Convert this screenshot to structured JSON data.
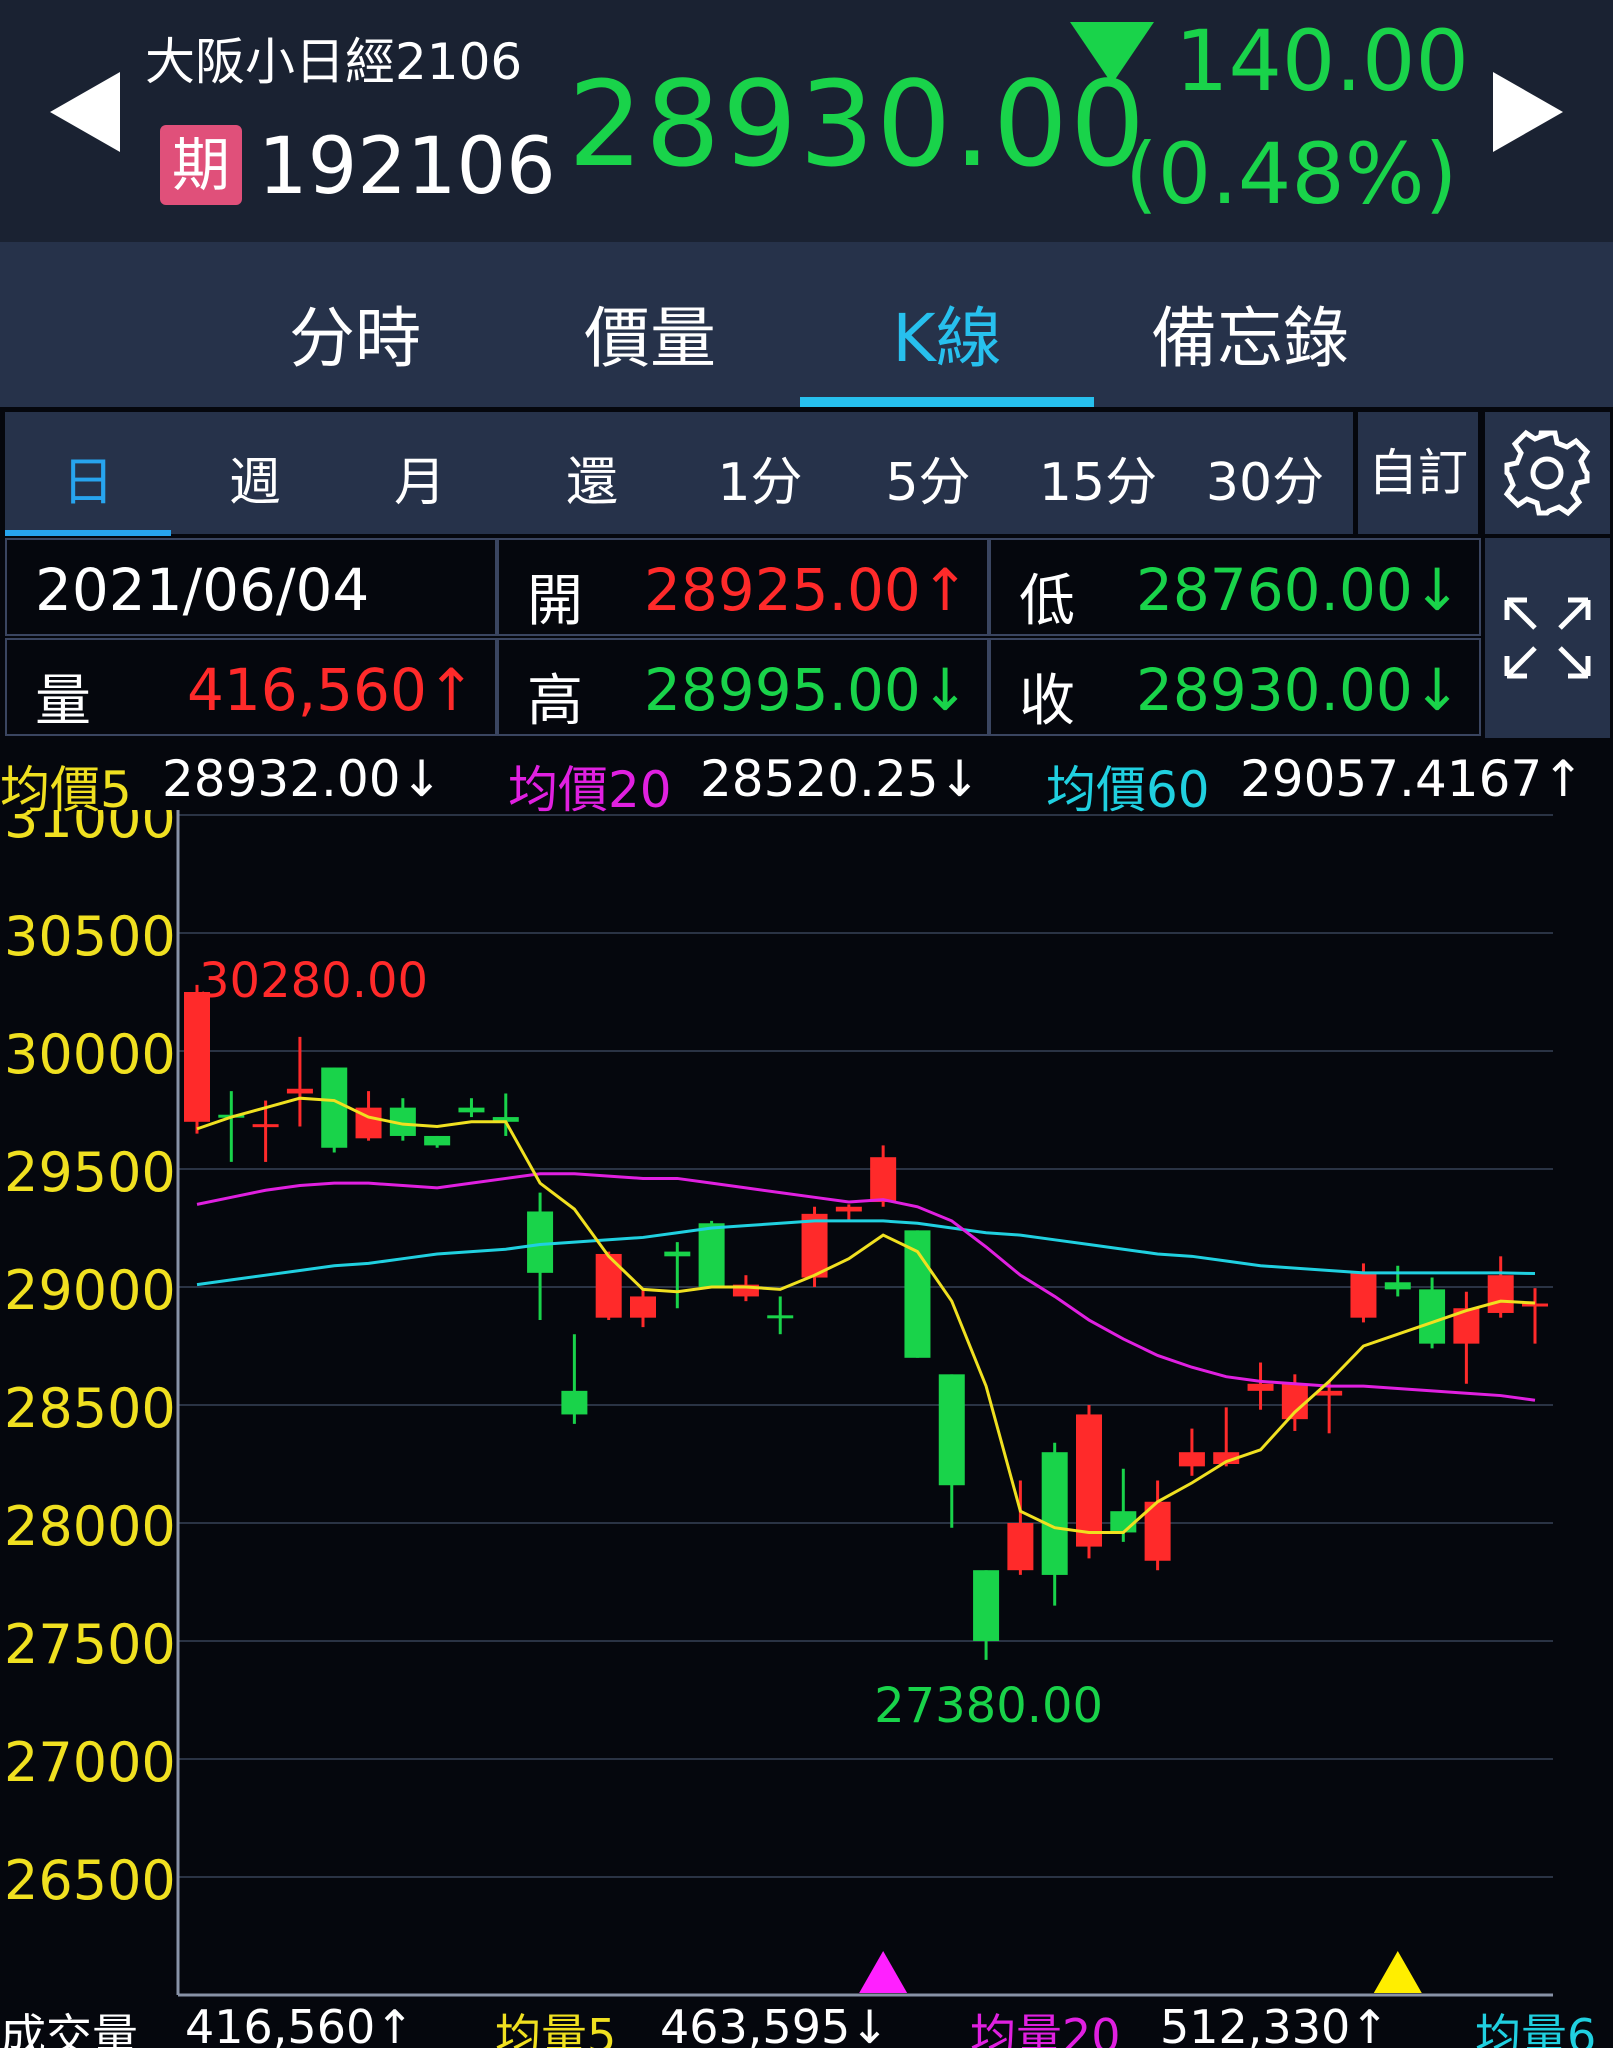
{
  "header": {
    "name": "大阪小日經2106",
    "badge": "期",
    "code": "192106",
    "price": "28930.00",
    "change": "140.00",
    "change_pct": "(0.48%)"
  },
  "tabs": [
    "分時",
    "價量",
    "K線",
    "備忘錄"
  ],
  "active_tab": "K線",
  "periods": [
    "日",
    "週",
    "月",
    "還",
    "1分",
    "5分",
    "15分",
    "30分"
  ],
  "active_period": "日",
  "custom_label": "自訂",
  "info": {
    "date": "2021/06/04",
    "open_label": "開",
    "open": "28925.00↑",
    "low_label": "低",
    "low": "28760.00↓",
    "vol_label": "量",
    "vol": "416,560↑",
    "high_label": "高",
    "high": "28995.00↓",
    "close_label": "收",
    "close": "28930.00↓"
  },
  "ma": {
    "ma5_label": "均價5",
    "ma5": "28932.00↓",
    "ma20_label": "均價20",
    "ma20": "28520.25↓",
    "ma60_label": "均價60",
    "ma60": "29057.4167↑"
  },
  "volume_row": {
    "vol_label": "成交量",
    "vol": "416,560↑",
    "v5_label": "均量5",
    "v5": "463,595↓",
    "v20_label": "均量20",
    "v20": "512,330↑",
    "v60_label": "均量6"
  },
  "colors": {
    "up": "#ff2a2a",
    "down": "#19d34a",
    "ma5": "#f0e020",
    "ma20": "#e020e0",
    "ma60": "#20d0e0",
    "axis": "#f0e020"
  },
  "chart_data": {
    "type": "candlestick",
    "ylim": [
      26000,
      31000
    ],
    "yticks": [
      "31000",
      "30500",
      "30000",
      "29500",
      "29000",
      "28500",
      "28000",
      "27500",
      "27000",
      "26500"
    ],
    "high_label": "30280.00",
    "low_label": "27380.00",
    "candles": [
      {
        "o": 29700,
        "c": 30250,
        "h": 30280,
        "l": 29650
      },
      {
        "o": 29730,
        "c": 29720,
        "h": 29830,
        "l": 29530
      },
      {
        "o": 29680,
        "c": 29690,
        "h": 29790,
        "l": 29530
      },
      {
        "o": 29820,
        "c": 29840,
        "h": 30060,
        "l": 29680
      },
      {
        "o": 29930,
        "c": 29590,
        "h": 29930,
        "l": 29570
      },
      {
        "o": 29630,
        "c": 29760,
        "h": 29830,
        "l": 29620
      },
      {
        "o": 29760,
        "c": 29640,
        "h": 29800,
        "l": 29620
      },
      {
        "o": 29640,
        "c": 29600,
        "h": 29640,
        "l": 29590
      },
      {
        "o": 29760,
        "c": 29740,
        "h": 29800,
        "l": 29720
      },
      {
        "o": 29720,
        "c": 29700,
        "h": 29820,
        "l": 29640
      },
      {
        "o": 29320,
        "c": 29060,
        "h": 29400,
        "l": 28860
      },
      {
        "o": 28560,
        "c": 28460,
        "h": 28800,
        "l": 28420
      },
      {
        "o": 28870,
        "c": 29140,
        "h": 29150,
        "l": 28860
      },
      {
        "o": 28870,
        "c": 28960,
        "h": 28990,
        "l": 28830
      },
      {
        "o": 29150,
        "c": 29130,
        "h": 29190,
        "l": 28910
      },
      {
        "o": 29270,
        "c": 29000,
        "h": 29280,
        "l": 29000
      },
      {
        "o": 28960,
        "c": 29010,
        "h": 29050,
        "l": 28940
      },
      {
        "o": 28880,
        "c": 28870,
        "h": 28960,
        "l": 28800
      },
      {
        "o": 29040,
        "c": 29310,
        "h": 29340,
        "l": 29000
      },
      {
        "o": 29320,
        "c": 29340,
        "h": 29350,
        "l": 29280
      },
      {
        "o": 29360,
        "c": 29550,
        "h": 29600,
        "l": 29340
      },
      {
        "o": 29240,
        "c": 28700,
        "h": 29240,
        "l": 28700
      },
      {
        "o": 28630,
        "c": 28160,
        "h": 28630,
        "l": 27980
      },
      {
        "o": 27800,
        "c": 27500,
        "h": 27800,
        "l": 27420
      },
      {
        "o": 27800,
        "c": 28000,
        "h": 28180,
        "l": 27780
      },
      {
        "o": 28300,
        "c": 27780,
        "h": 28340,
        "l": 27650
      },
      {
        "o": 27900,
        "c": 28460,
        "h": 28500,
        "l": 27850
      },
      {
        "o": 28050,
        "c": 27960,
        "h": 28230,
        "l": 27920
      },
      {
        "o": 27840,
        "c": 28090,
        "h": 28180,
        "l": 27800
      },
      {
        "o": 28240,
        "c": 28300,
        "h": 28400,
        "l": 28200
      },
      {
        "o": 28250,
        "c": 28300,
        "h": 28490,
        "l": 28240
      },
      {
        "o": 28560,
        "c": 28590,
        "h": 28680,
        "l": 28480
      },
      {
        "o": 28440,
        "c": 28590,
        "h": 28630,
        "l": 28390
      },
      {
        "o": 28540,
        "c": 28560,
        "h": 28600,
        "l": 28380
      },
      {
        "o": 28870,
        "c": 29060,
        "h": 29100,
        "l": 28850
      },
      {
        "o": 29020,
        "c": 28990,
        "h": 29090,
        "l": 28960
      },
      {
        "o": 28990,
        "c": 28760,
        "h": 29040,
        "l": 28740
      },
      {
        "o": 28760,
        "c": 28910,
        "h": 28980,
        "l": 28590
      },
      {
        "o": 28890,
        "c": 29050,
        "h": 29130,
        "l": 28870
      },
      {
        "o": 28925,
        "c": 28930,
        "h": 28995,
        "l": 28760
      }
    ],
    "ma5": [
      29670,
      29720,
      29760,
      29800,
      29790,
      29720,
      29690,
      29680,
      29700,
      29700,
      29440,
      29330,
      29130,
      28990,
      28980,
      29000,
      29000,
      28990,
      29050,
      29120,
      29220,
      29150,
      28940,
      28580,
      28050,
      27980,
      27960,
      27960,
      28090,
      28170,
      28260,
      28310,
      28470,
      28600,
      28750,
      28800,
      28850,
      28900,
      28940,
      28932
    ],
    "ma20": [
      29350,
      29380,
      29410,
      29430,
      29440,
      29440,
      29430,
      29420,
      29440,
      29460,
      29480,
      29480,
      29470,
      29460,
      29460,
      29440,
      29420,
      29400,
      29380,
      29360,
      29370,
      29340,
      29280,
      29170,
      29050,
      28960,
      28860,
      28780,
      28710,
      28660,
      28620,
      28600,
      28590,
      28580,
      28580,
      28570,
      28560,
      28550,
      28540,
      28520
    ],
    "ma60": [
      29010,
      29030,
      29050,
      29070,
      29090,
      29100,
      29120,
      29140,
      29150,
      29160,
      29180,
      29190,
      29200,
      29210,
      29230,
      29250,
      29260,
      29270,
      29280,
      29280,
      29280,
      29270,
      29250,
      29230,
      29220,
      29200,
      29180,
      29160,
      29140,
      29130,
      29110,
      29090,
      29080,
      29070,
      29060,
      29060,
      29060,
      29060,
      29060,
      29057
    ],
    "markers": [
      {
        "index": 20,
        "color": "#ff20ff"
      },
      {
        "index": 35,
        "color": "#ffee00"
      }
    ]
  }
}
